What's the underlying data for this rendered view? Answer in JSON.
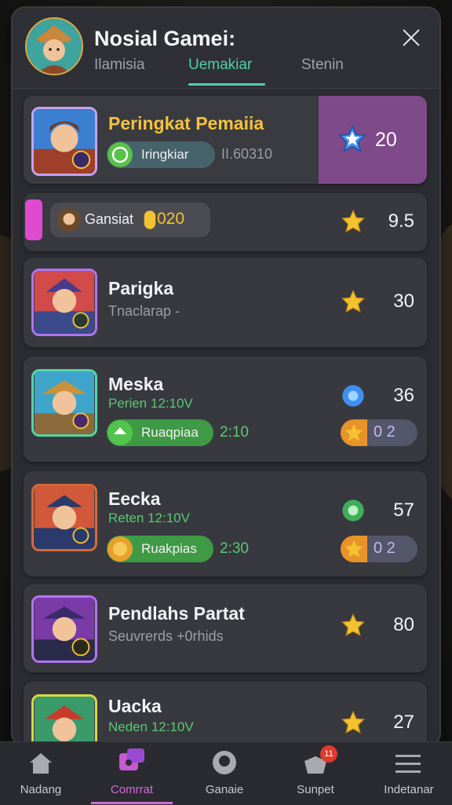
{
  "header": {
    "title": "Nosial Gamei:",
    "tabs": [
      "Ilamisia",
      "Uemakiar",
      "Stenin"
    ]
  },
  "featured": {
    "title": "Peringkat Pemaiia",
    "pill_label": "Iringkiar",
    "meta": "II.60310",
    "score": "20"
  },
  "chip_row": {
    "label": "Gansiat",
    "value": "020",
    "score": "9.5"
  },
  "rows": [
    {
      "name": "Parigka",
      "sub": "Tnaclarap -",
      "score": "30"
    },
    {
      "name": "Meska",
      "sub": "Perien 12:10V",
      "pill_label": "Ruaqpiaa",
      "pill_value": "2:10",
      "score": "36",
      "badge_value": "0 2"
    },
    {
      "name": "Eecka",
      "sub": "Reten 12:10V",
      "pill_label": "Ruakpias",
      "pill_value": "2:30",
      "score": "57",
      "badge_value": "0 2"
    },
    {
      "name": "Pendlahs Partat",
      "sub": "Seuvrerds +0rhids",
      "score": "80"
    },
    {
      "name": "Uacka",
      "sub": "Neden 12:10V",
      "score": "27"
    }
  ],
  "nav": {
    "items": [
      "Nadang",
      "Comrrat",
      "Ganaie",
      "Sunpet",
      "Indetanar"
    ],
    "active": "Comrrat",
    "badge": "11"
  },
  "colors": {
    "accent_green": "#4fd0a3",
    "accent_purple": "#7e4a8a",
    "nav_active": "#d46ad8",
    "gold": "#f2c230"
  }
}
